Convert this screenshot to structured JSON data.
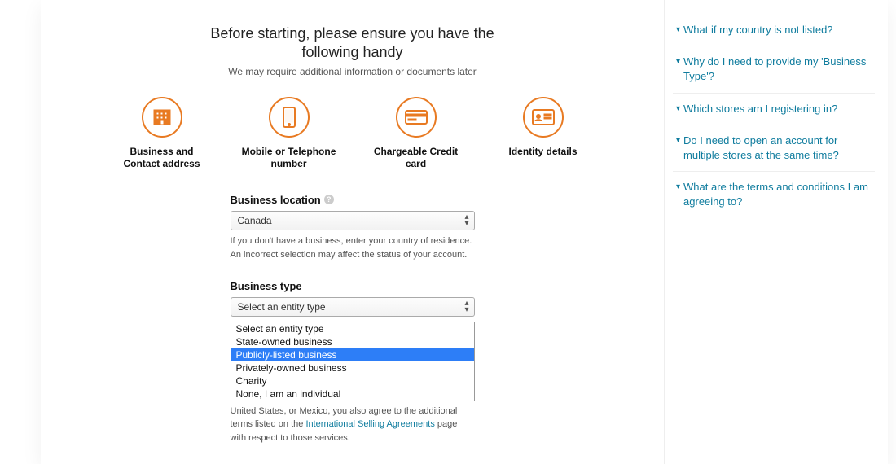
{
  "header": {
    "title": "Before starting, please ensure you have the following handy",
    "subtitle": "We may require additional information or documents later"
  },
  "requirements": [
    {
      "id": "building-icon",
      "label": "Business and Contact address"
    },
    {
      "id": "phone-icon",
      "label": "Mobile or Telephone number"
    },
    {
      "id": "credit-card-icon",
      "label": "Chargeable Credit card"
    },
    {
      "id": "id-card-icon",
      "label": "Identity details"
    }
  ],
  "form": {
    "location_label": "Business location",
    "location_value": "Canada",
    "location_hint1": "If you don't have a business, enter your country of residence.",
    "location_hint2": "An incorrect selection may affect the status of your account.",
    "type_label": "Business type",
    "type_value": "Select an entity type",
    "type_options": [
      "Select an entity type",
      "State-owned business",
      "Publicly-listed business",
      "Privately-owned business",
      "Charity",
      "None, I am an individual"
    ],
    "type_selected_index": 2,
    "agreement_prefix": "United States, or Mexico, you also agree to the additional terms listed on the ",
    "agreement_link": "International Selling Agreements",
    "agreement_suffix": " page with respect to those services."
  },
  "faq": [
    "What if my country is not listed?",
    "Why do I need to provide my 'Business Type'?",
    "Which stores am I registering in?",
    "Do I need to open an account for multiple stores at the same time?",
    "What are the terms and conditions I am agreeing to?"
  ]
}
